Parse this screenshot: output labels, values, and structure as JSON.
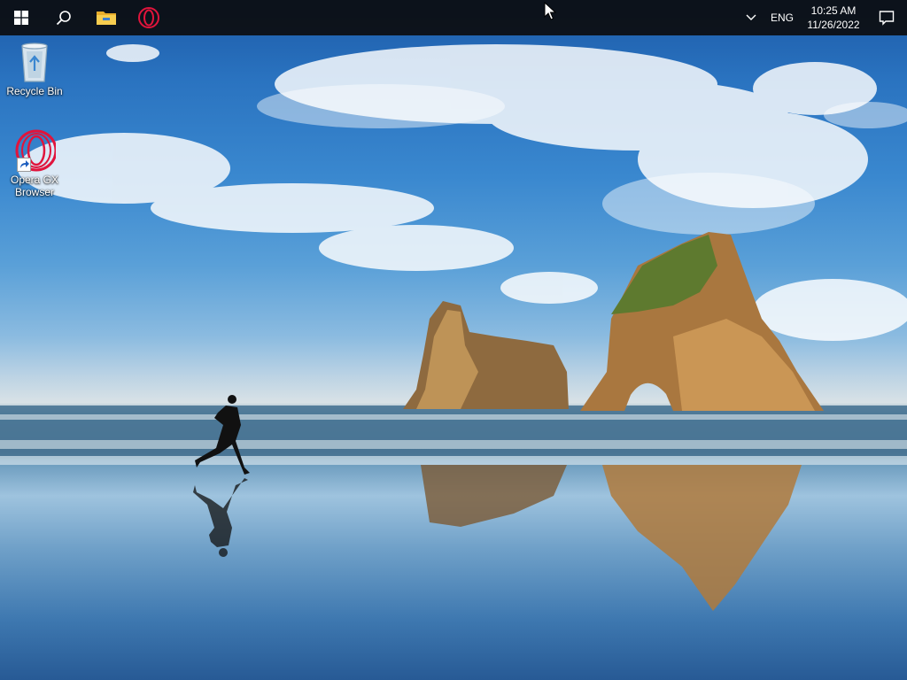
{
  "taskbar": {
    "buttons": [
      {
        "name": "start",
        "icon": "windows-logo-icon"
      },
      {
        "name": "search",
        "icon": "search-icon"
      },
      {
        "name": "file-explorer",
        "icon": "folder-icon"
      },
      {
        "name": "opera-gx",
        "icon": "opera-gx-icon"
      }
    ],
    "tray": {
      "language": "ENG",
      "time": "10:25 AM",
      "date": "11/26/2022"
    }
  },
  "desktop": {
    "icons": [
      {
        "label": "Recycle Bin",
        "icon": "recycle-bin-icon"
      },
      {
        "label": "Opera GX Browser",
        "icon": "opera-gx-icon",
        "shortcut": true
      }
    ]
  },
  "colors": {
    "taskbar": "#0c0e12",
    "opera_red": "#e0143c",
    "folder_yellow": "#f4c542"
  }
}
